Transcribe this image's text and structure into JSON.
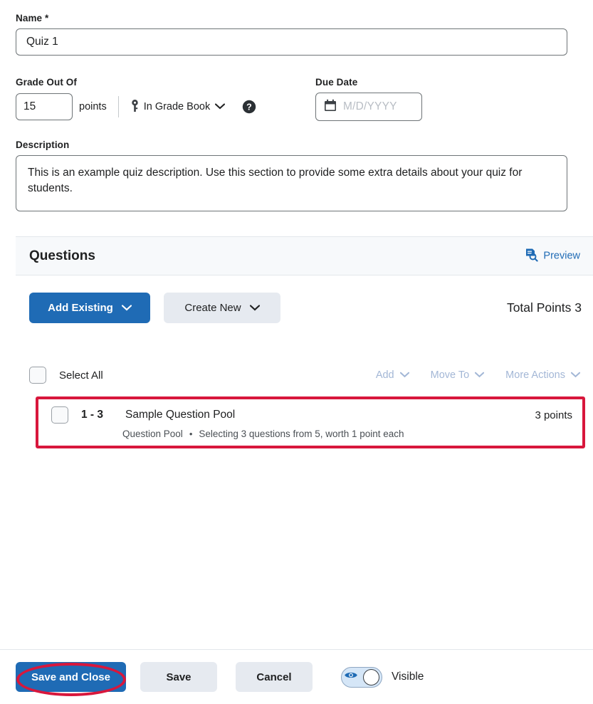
{
  "form": {
    "name": {
      "label": "Name",
      "required_marker": "*",
      "value": "Quiz 1",
      "placeholder": ""
    },
    "grade_out_of": {
      "label": "Grade Out Of",
      "value": "15",
      "units_label": "points",
      "grade_book_label": "In Grade Book",
      "grade_book_icon": "key-icon",
      "chevron_icon": "chevron-down-icon",
      "help_icon": "help-circle-icon"
    },
    "due_date": {
      "label": "Due Date",
      "value": "",
      "placeholder": "M/D/YYYY",
      "calendar_icon": "calendar-icon"
    },
    "description": {
      "label": "Description",
      "value": "This is an example quiz description. Use this section to provide some extra details about your quiz for students."
    }
  },
  "questions": {
    "section_title": "Questions",
    "preview_label": "Preview",
    "preview_icon": "document-search-icon",
    "add_existing_label": "Add Existing",
    "create_new_label": "Create New",
    "total_points_label": "Total Points 3",
    "select_all_label": "Select All",
    "bulk_actions": [
      {
        "label": "Add",
        "icon": "chevron-down-icon",
        "disabled": true
      },
      {
        "label": "Move To",
        "icon": "chevron-down-icon",
        "disabled": true
      },
      {
        "label": "More Actions",
        "icon": "chevron-down-icon",
        "disabled": true
      }
    ],
    "items": [
      {
        "range": "1 - 3",
        "title": "Sample Question Pool",
        "type_label": "Question Pool",
        "detail": "Selecting 3 questions from 5, worth 1 point each",
        "points": "3 points"
      }
    ]
  },
  "footer": {
    "save_and_close_label": "Save and Close",
    "save_label": "Save",
    "cancel_label": "Cancel",
    "visible_label": "Visible",
    "visible_state": "on"
  },
  "annotations": {
    "highlight_color": "#d8173c",
    "highlighted_row": "Sample Question Pool",
    "highlighted_button": "Save and Close"
  },
  "colors": {
    "primary_blue": "#1f6bb5",
    "secondary_gray": "#e6eaf0",
    "band_background": "#f7f9fb",
    "disabled_link": "#a3b7d6",
    "annotation_red": "#d8173c"
  }
}
